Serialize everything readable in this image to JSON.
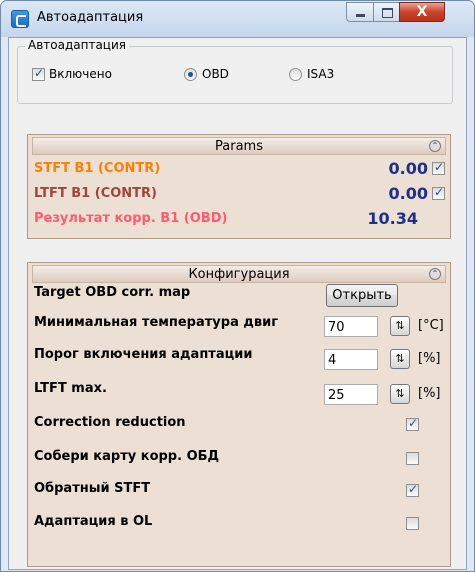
{
  "window": {
    "title": "Автоадаптация",
    "close_glyph": "X"
  },
  "mode_group": {
    "legend": "Автоадаптация",
    "enabled_label": "Включено",
    "enabled": true,
    "options": [
      "OBD",
      "ISA3"
    ],
    "selected": "OBD"
  },
  "params": {
    "title": "Params",
    "rows": [
      {
        "label": "STFT B1 (CONTR)",
        "value": "0.00",
        "checked": true,
        "color": "#ff7f00"
      },
      {
        "label": "LTFT B1 (CONTR)",
        "value": "0.00",
        "checked": true,
        "color": "#a0453a"
      },
      {
        "label": "Результат корр. B1 (OBD)",
        "value": "10.34",
        "color": "#ff5a6e"
      }
    ]
  },
  "config": {
    "title": "Конфигурация",
    "target_map_label": "Target OBD corr. map",
    "open_button": "Открыть",
    "min_temp_label": "Минимальная температура двиг",
    "min_temp_value": "70",
    "min_temp_unit": "[°C]",
    "threshold_label": "Порог включения адаптации",
    "threshold_value": "4",
    "threshold_unit": "[%]",
    "ltft_max_label": "LTFT max.",
    "ltft_max_value": "25",
    "ltft_max_unit": "[%]",
    "checks": [
      {
        "label": "Correction reduction",
        "checked": true
      },
      {
        "label": "Собери карту корр. ОБД",
        "checked": false
      },
      {
        "label": "Обратный STFT",
        "checked": true
      },
      {
        "label": "Адаптация в OL",
        "checked": false
      }
    ]
  },
  "colors": {
    "value_blue": "#1f2f8f",
    "panel_bg": "#ece0d5"
  }
}
